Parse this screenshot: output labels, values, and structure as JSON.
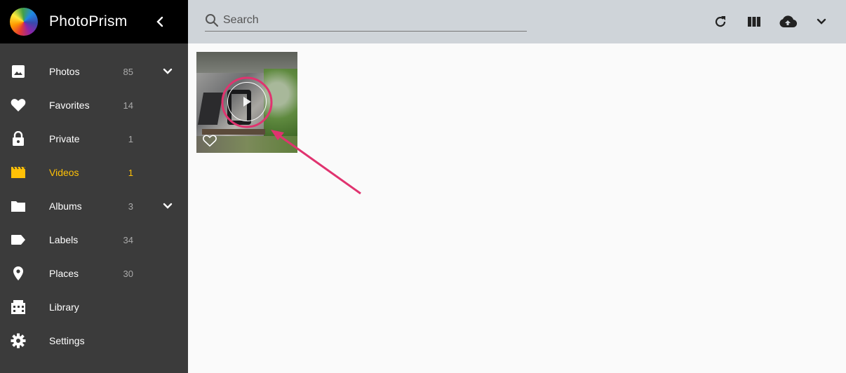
{
  "app": {
    "title": "PhotoPrism"
  },
  "nav": {
    "items": [
      {
        "label": "Photos",
        "count": "85",
        "icon": "image-icon"
      },
      {
        "label": "Favorites",
        "count": "14",
        "icon": "heart-icon"
      },
      {
        "label": "Private",
        "count": "1",
        "icon": "lock-icon"
      },
      {
        "label": "Videos",
        "count": "1",
        "icon": "movie-icon"
      },
      {
        "label": "Albums",
        "count": "3",
        "icon": "folder-icon"
      },
      {
        "label": "Labels",
        "count": "34",
        "icon": "label-icon"
      },
      {
        "label": "Places",
        "count": "30",
        "icon": "place-icon"
      },
      {
        "label": "Library",
        "count": "",
        "icon": "library-icon"
      },
      {
        "label": "Settings",
        "count": "",
        "icon": "gear-icon"
      }
    ],
    "active": "Videos",
    "active_color": "#ffc107"
  },
  "search": {
    "placeholder": "Search",
    "value": ""
  },
  "toolbar": {
    "icons": [
      "refresh-icon",
      "view-columns-icon",
      "upload-icon",
      "chevron-down-icon"
    ]
  },
  "colors": {
    "sidebar_bg": "#3b3b3b",
    "brand_bg": "#000000",
    "topbar_bg": "#cfd4d9",
    "content_bg": "#fafafa",
    "annotation": "#e0336f"
  }
}
